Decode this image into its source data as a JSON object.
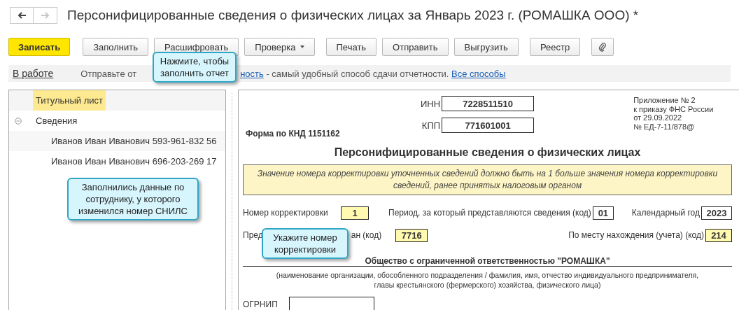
{
  "window": {
    "title": "Персонифицированные сведения о физических лицах за Январь 2023 г. (РОМАШКА ООО) *"
  },
  "nav": [
    {
      "kind": "back",
      "disabled": false
    },
    {
      "kind": "forward",
      "disabled": true
    }
  ],
  "toolbar": [
    {
      "kind": "primary",
      "label": "Записать"
    },
    {
      "kind": "plain",
      "label": "Заполнить"
    },
    {
      "kind": "plain",
      "label": "Расшифровать"
    },
    {
      "kind": "dropdown",
      "label": "Проверка"
    },
    {
      "kind": "plain",
      "label": "Печать"
    },
    {
      "kind": "plain",
      "label": "Отправить"
    },
    {
      "kind": "plain",
      "label": "Выгрузить"
    },
    {
      "kind": "plain",
      "label": "Реестр"
    },
    {
      "kind": "attach"
    }
  ],
  "info_bar": {
    "status_link": "В работе",
    "text_start": "Отправьте от",
    "link_fragment": "ность",
    "text_end": " - самый удобный способ сдачи отчетности.",
    "all_link": "Все способы"
  },
  "tree": [
    {
      "label": "Титульный лист",
      "selected": true
    },
    {
      "label": "Сведения",
      "selected": false,
      "expanded": true,
      "children": [
        {
          "label": "Иванов Иван Иванович 593-961-832 56",
          "selected": false
        },
        {
          "label": "Иванов Иван Иванович 696-203-269 17",
          "selected": false
        }
      ]
    }
  ],
  "form": {
    "inn_label": "ИНН",
    "inn": "7228511510",
    "kpp_label": "КПП",
    "kpp": "771601001",
    "appendix": [
      "Приложение № 2",
      "к приказу ФНС России",
      "от 29.09.2022",
      "№ ЕД-7-11/878@"
    ],
    "knd": "Форма по КНД 1151162",
    "heading": "Персонифицированные сведения о физических лицах",
    "note": "Значение номера корректировки уточненных сведений должно быть на 1 больше значения номера корректировки сведений, ранее принятых налоговым органом",
    "correction_label": "Номер корректировки",
    "correction": "1",
    "period_label": "Период, за который представляются сведения (код)",
    "period": "01",
    "year_label": "Календарный год",
    "year": "2023",
    "authority_label_start": "Пред",
    "authority_label_end": "ан (код)",
    "authority": "7716",
    "location_label": "По месту нахождения (учета) (код)",
    "location": "214",
    "org_name": "Общество с ограниченной ответственностью \"РОМАШКА\"",
    "org_caption": [
      "(наименование организации, обособленного подразделения / фамилия, имя, отчество индивидуального предпринимателя,",
      "главы крестьянского (фермерского) хозяйства, физического лица)"
    ],
    "ogrnip_label": "ОГРНИП"
  },
  "callouts": [
    {
      "text": "Нажмите, чтобы заполнить отчет"
    },
    {
      "text": "Заполнились данные по сотруднику, у которого изменился номер СНИЛС"
    },
    {
      "text": "Укажите номер корректировки"
    }
  ]
}
